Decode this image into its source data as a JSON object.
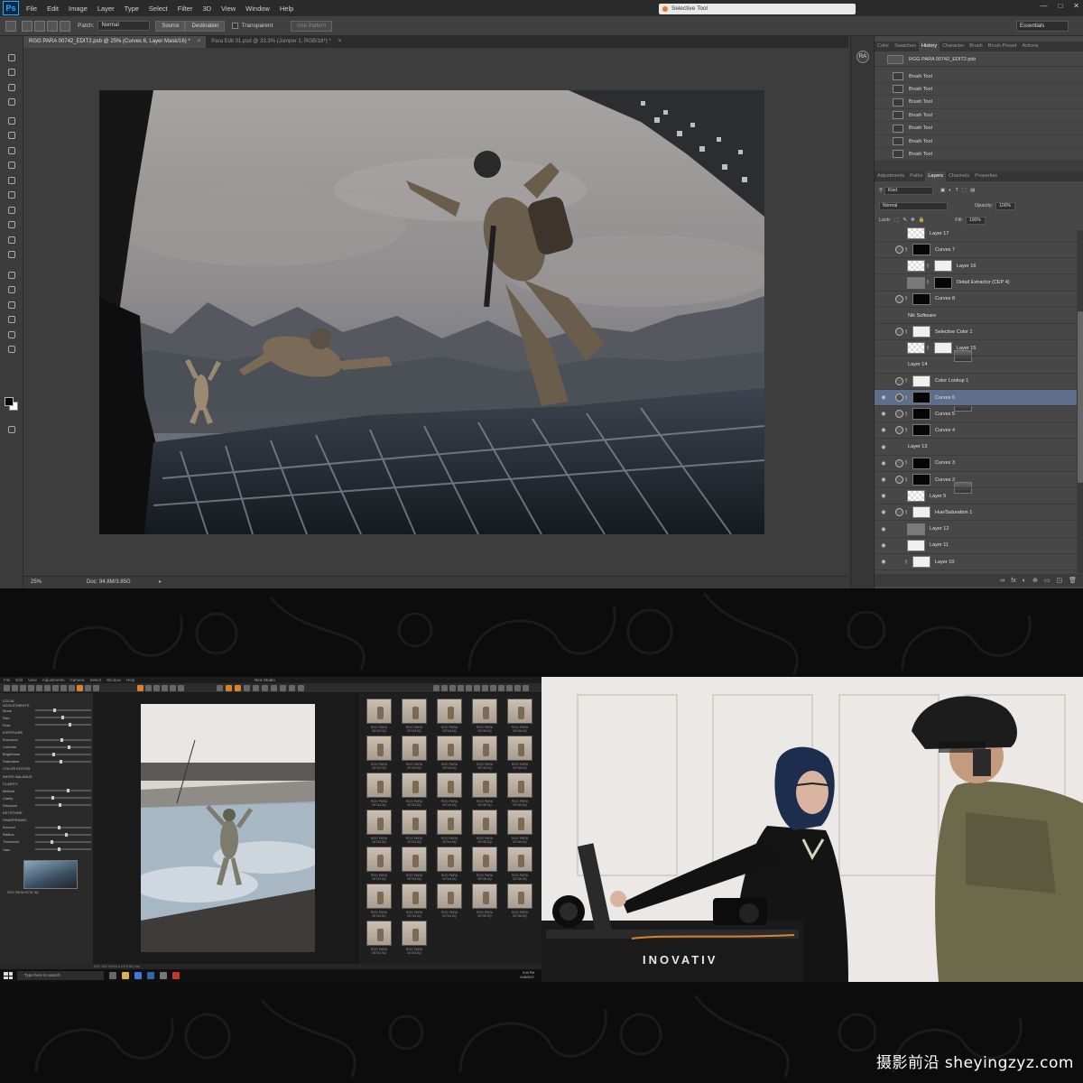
{
  "photoshop": {
    "logo": "Ps",
    "menu": [
      "File",
      "Edit",
      "Image",
      "Layer",
      "Type",
      "Select",
      "Filter",
      "3D",
      "View",
      "Window",
      "Help"
    ],
    "search_field": "Selective Tool",
    "window_controls": [
      "—",
      "□",
      "✕"
    ],
    "options": {
      "patch_label": "Patch:",
      "patch_value": "Normal",
      "source_button": "Source",
      "destination_button": "Destination",
      "transparent_label": "Transparent",
      "use_pattern_button": "Use Pattern",
      "workspace": "Essentials"
    },
    "document_tabs": [
      {
        "label": "RGG PARA 00742_EDIT2.psb @ 25% (Curves 6, Layer Mask/16) *",
        "active": true
      },
      {
        "label": "Para Edit 01.psd @ 33.3% (Jumper 1, RGB/16*) *",
        "active": false
      }
    ],
    "status": {
      "zoom": "25%",
      "doc": "Doc: 94.8M/3.85G"
    },
    "avatar_initials": "RA",
    "history_panel": {
      "tabs": [
        "Color",
        "Swatches",
        "History",
        "Character",
        "Brush",
        "Brush Preset",
        "Actions"
      ],
      "active_tab": "History",
      "snapshot": "RGG PARA 00742_EDIT2.psb",
      "steps": [
        "Brush Tool",
        "Brush Tool",
        "Brush Tool",
        "Brush Tool",
        "Brush Tool",
        "Brush Tool",
        "Brush Tool"
      ]
    },
    "layers_panel": {
      "tabs": [
        "Adjustments",
        "Paths",
        "Layers",
        "Channels",
        "Properties"
      ],
      "active_tab": "Layers",
      "kind": "Kind",
      "blend_mode": "Normal",
      "opacity_label": "Opacity:",
      "opacity": "100%",
      "lock_label": "Lock:",
      "fill_label": "Fill:",
      "fill": "100%",
      "layers": [
        {
          "name": "Layer 17",
          "thumb": "check",
          "adj": false,
          "mask": null,
          "eye": false,
          "selected": false
        },
        {
          "name": "Curves 7",
          "thumb": null,
          "adj": true,
          "mask": "black",
          "eye": false,
          "selected": false
        },
        {
          "name": "Layer 16",
          "thumb": "check",
          "adj": false,
          "mask": "white",
          "eye": false,
          "selected": false
        },
        {
          "name": "Detail Extractor (CEP 4)",
          "thumb": "gray",
          "adj": false,
          "mask": "black",
          "eye": false,
          "selected": false
        },
        {
          "name": "Curves 8",
          "thumb": null,
          "adj": true,
          "mask": "black",
          "eye": false,
          "selected": false
        },
        {
          "name": "Nik Software",
          "thumb": "photo",
          "adj": false,
          "mask": null,
          "eye": false,
          "selected": false
        },
        {
          "name": "Selective Color 1",
          "thumb": null,
          "adj": true,
          "mask": "white",
          "eye": false,
          "selected": false
        },
        {
          "name": "Layer 15",
          "thumb": "check",
          "adj": false,
          "mask": "white",
          "eye": false,
          "selected": false
        },
        {
          "name": "Layer 14",
          "thumb": "photo",
          "adj": false,
          "mask": null,
          "eye": false,
          "selected": false
        },
        {
          "name": "Color Lookup 1",
          "thumb": null,
          "adj": true,
          "mask": "white",
          "eye": false,
          "selected": false
        },
        {
          "name": "Curves 6",
          "thumb": null,
          "adj": true,
          "mask": "black",
          "eye": true,
          "selected": true
        },
        {
          "name": "Curves 5",
          "thumb": null,
          "adj": true,
          "mask": "black",
          "eye": true,
          "selected": false
        },
        {
          "name": "Curves 4",
          "thumb": null,
          "adj": true,
          "mask": "black",
          "eye": true,
          "selected": false
        },
        {
          "name": "Layer 13",
          "thumb": "photo",
          "adj": false,
          "mask": null,
          "eye": true,
          "selected": false
        },
        {
          "name": "Curves 3",
          "thumb": null,
          "adj": true,
          "mask": "black",
          "eye": true,
          "selected": false
        },
        {
          "name": "Curves 2",
          "thumb": null,
          "adj": true,
          "mask": "black",
          "eye": true,
          "selected": false
        },
        {
          "name": "Layer 5",
          "thumb": "check",
          "adj": false,
          "mask": null,
          "eye": true,
          "selected": false
        },
        {
          "name": "Hue/Saturation 1",
          "thumb": null,
          "adj": true,
          "mask": "white",
          "eye": true,
          "selected": false
        },
        {
          "name": "Layer 12",
          "thumb": "gray",
          "adj": false,
          "mask": null,
          "eye": true,
          "selected": false
        },
        {
          "name": "Layer 11",
          "thumb": "white",
          "adj": false,
          "mask": null,
          "eye": true,
          "selected": false
        },
        {
          "name": "Layer 10",
          "thumb": "photo",
          "adj": false,
          "mask": "white",
          "eye": true,
          "selected": false
        }
      ],
      "footer_icons": [
        "∞",
        "fx",
        "◐",
        "⊕",
        "▭",
        "◳",
        "🗑"
      ]
    }
  },
  "capture_one": {
    "menu": [
      "File",
      "Edit",
      "View",
      "Adjustments",
      "Camera",
      "Select",
      "Window",
      "Help"
    ],
    "title": "Nick Studio",
    "tool_rows": [
      "LOCAL ADJUSTMENTS",
      "Mode",
      "Size",
      "Flow",
      "EXPOSURE",
      "Exposure",
      "Contrast",
      "Brightness",
      "Saturation",
      "COLOR EDITOR",
      "WHITE BALANCE",
      "CLARITY",
      "Method",
      "Clarity",
      "Structure",
      "KEYSTONE",
      "SHARPENING",
      "Amount",
      "Radius",
      "Threshold",
      "Halo"
    ],
    "method_value": "Natural",
    "mode_value": "Mask",
    "thumbnail_caption": "RGG PARA 00751.IIQ",
    "viewer_status": "ISO 100   1/250 s   f/5.6   55 mm",
    "thumb_captions": [
      "RGG PARA 00742.IIQ",
      "RGG PARA 00743.IIQ",
      "RGG PARA 00744.IIQ",
      "RGG PARA 00745.IIQ",
      "RGG PARA 00746.IIQ"
    ],
    "selected_thumb_index": 33,
    "taskbar": {
      "search_placeholder": "Type here to search",
      "time": "9:40 PM",
      "date": "9/18/2017"
    }
  },
  "studio": {
    "brand_text": "INOVATIV"
  },
  "watermark": "摄影前沿 sheyingzyz.com"
}
